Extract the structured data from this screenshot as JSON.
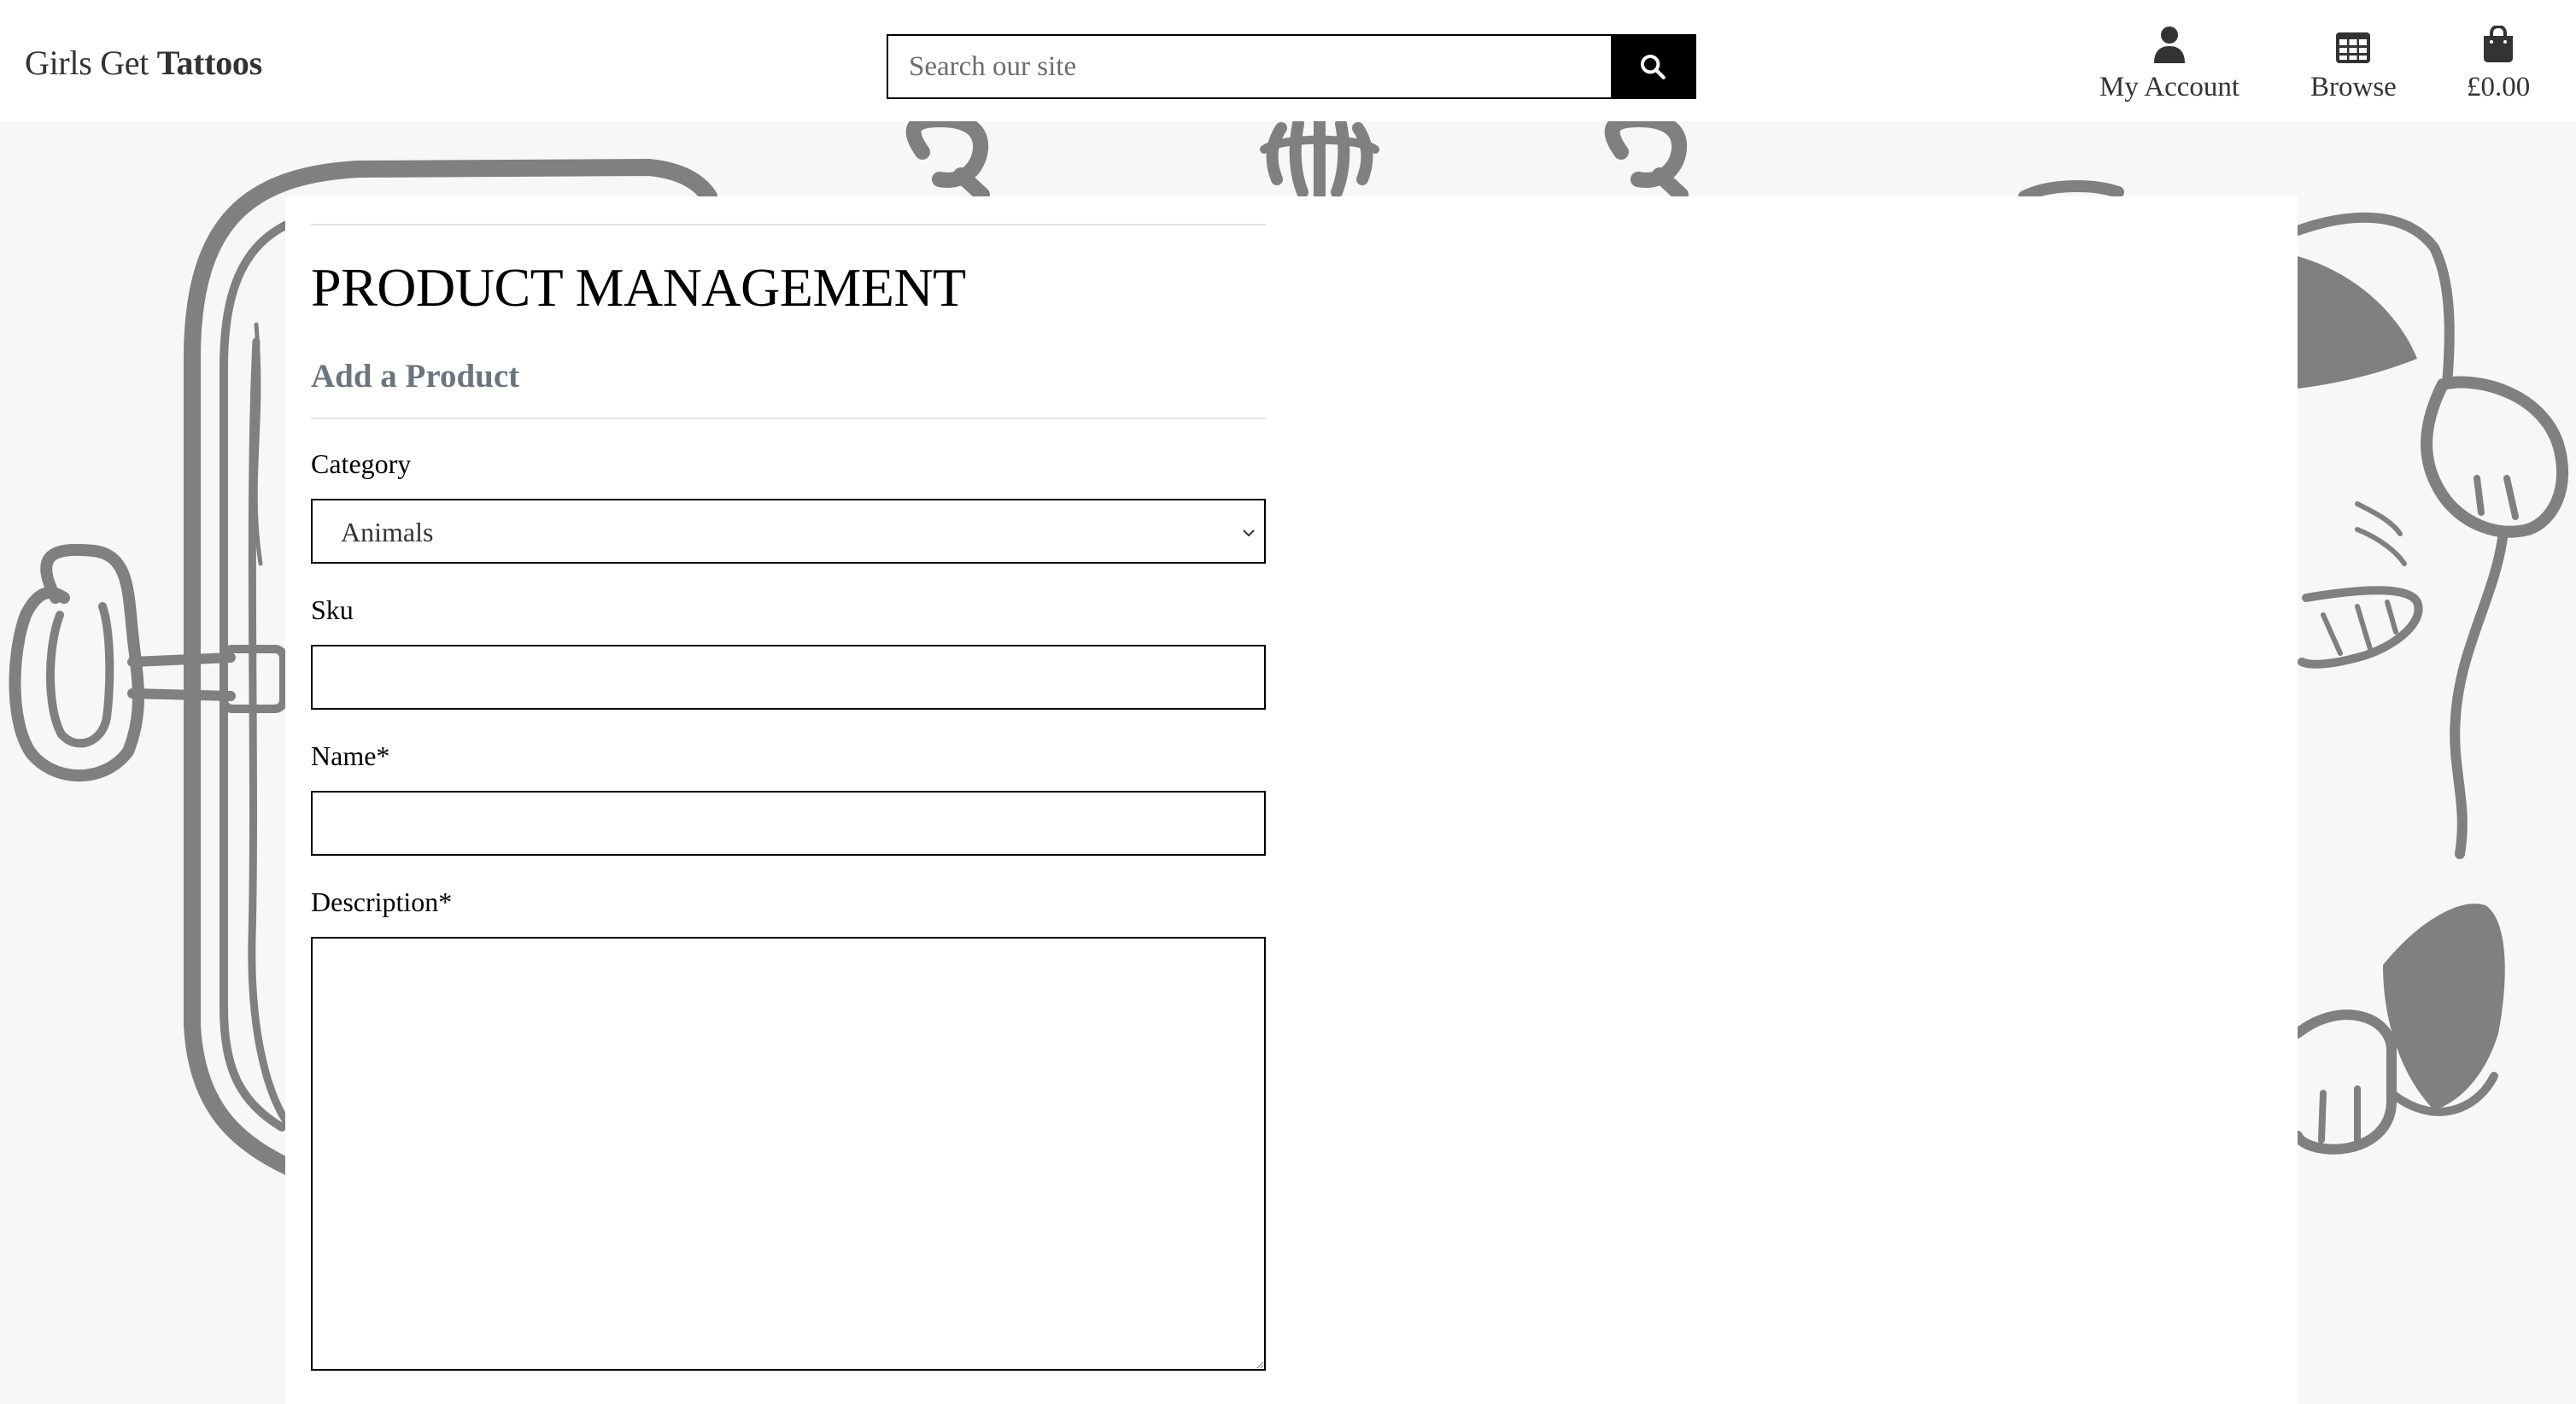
{
  "header": {
    "brand_part1": "Girls Get",
    "brand_part2": "Tattoos",
    "search": {
      "placeholder": "Search our site",
      "value": ""
    },
    "nav": {
      "account_label": "My Account",
      "browse_label": "Browse",
      "cart_total": "£0.00"
    }
  },
  "main": {
    "title": "PRODUCT MANAGEMENT",
    "subtitle": "Add a Product",
    "form": {
      "category_label": "Category",
      "category_value": "Animals",
      "sku_label": "Sku",
      "sku_value": "",
      "name_label": "Name*",
      "name_value": "",
      "description_label": "Description*",
      "description_value": ""
    }
  },
  "icons": {
    "search": "search-icon",
    "account": "user-icon",
    "browse": "grid-icon",
    "cart": "shopping-bag-icon",
    "select": "chevron-down-icon"
  },
  "colors": {
    "header_bg": "#ffffff",
    "page_bg": "#f7f7f7",
    "search_button": "#000000",
    "subtitle": "#6c757d",
    "background_art": "#808080"
  }
}
